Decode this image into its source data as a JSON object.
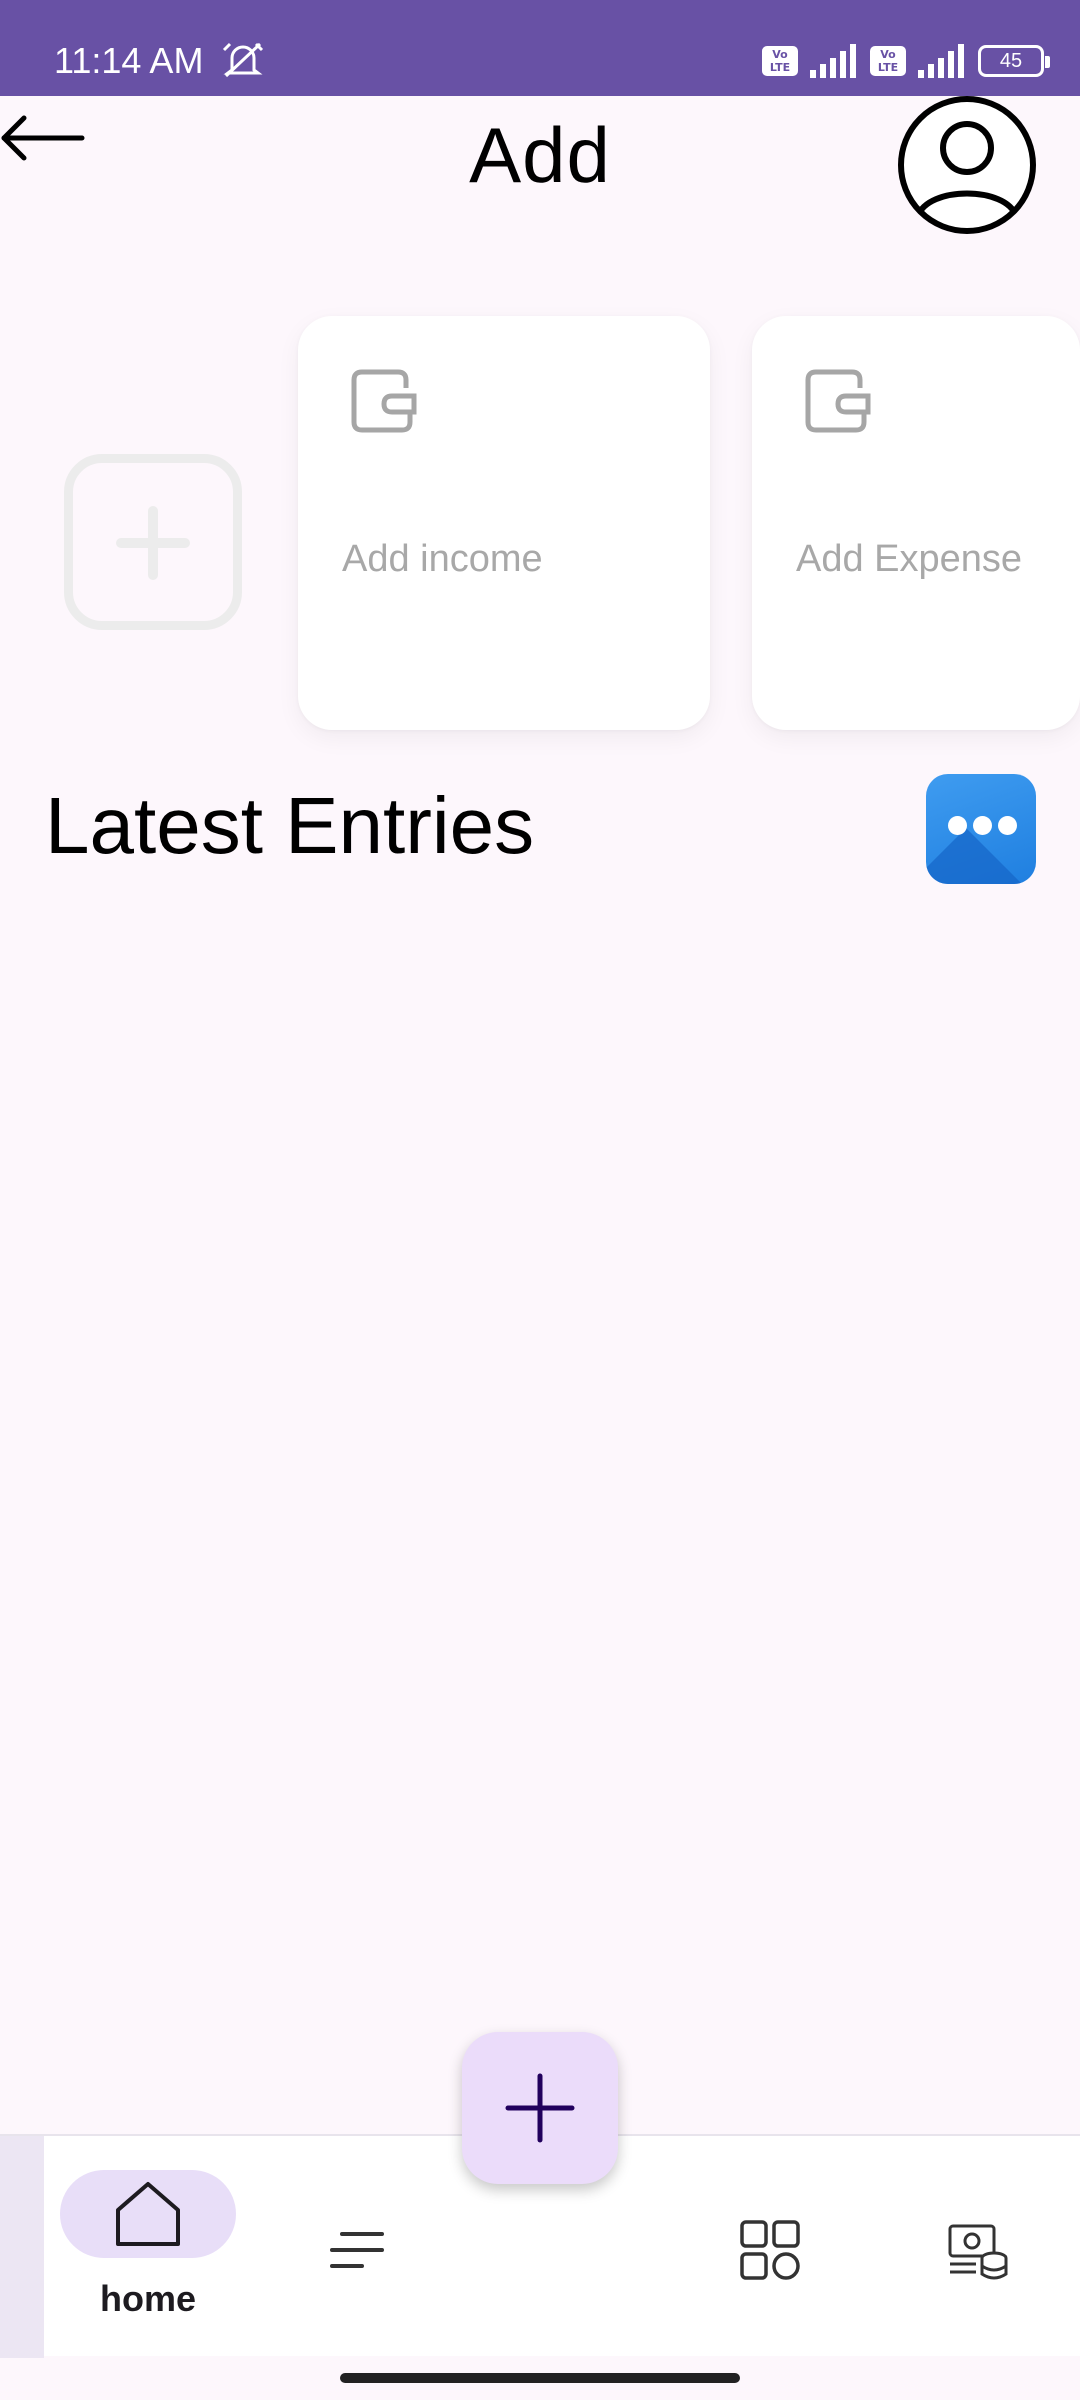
{
  "status_bar": {
    "time": "11:14 AM",
    "battery": "45",
    "volte_label": "Vo LTE"
  },
  "header": {
    "title": "Add"
  },
  "cards": {
    "income_label": "Add income",
    "expense_label": "Add Expense"
  },
  "section": {
    "title": "Latest Entries"
  },
  "bottom_nav": {
    "home_label": "home"
  },
  "colors": {
    "status_bar": "#6851a5",
    "background": "#fdf7fc",
    "nav_active_pill": "#e8def8",
    "fab": "#ebdcfa",
    "more_button": "#2b8be6"
  },
  "icons": [
    "back-arrow-icon",
    "profile-icon",
    "plus-icon",
    "wallet-icon",
    "more-icon",
    "home-icon",
    "menu-lines-icon",
    "grid-icon",
    "money-icon"
  ]
}
